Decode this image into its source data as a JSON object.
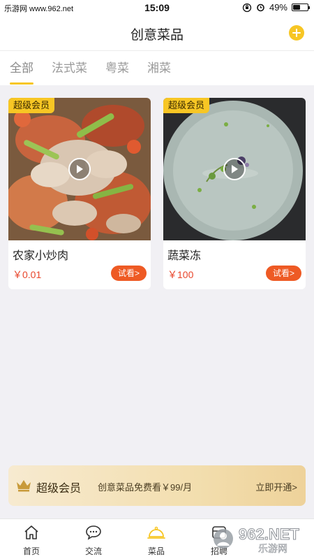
{
  "status": {
    "carrier": "乐游网 www.962.net",
    "time": "15:09",
    "battery_pct_text": "49%",
    "battery_level": 0.49
  },
  "header": {
    "title": "创意菜品"
  },
  "tabs": [
    {
      "label": "全部",
      "active": true
    },
    {
      "label": "法式菜"
    },
    {
      "label": "粤菜"
    },
    {
      "label": "湘菜"
    }
  ],
  "dishes": [
    {
      "badge": "超级会员",
      "name": "农家小炒肉",
      "price": "￥0.01",
      "try_label": "试看>"
    },
    {
      "badge": "超级会员",
      "name": "蔬菜冻",
      "price": "￥100",
      "try_label": "试看>"
    }
  ],
  "member_banner": {
    "title": "超级会员",
    "desc": "创意菜品免费看￥99/月",
    "action": "立即开通>"
  },
  "bottom_nav": [
    {
      "label": "首页",
      "icon": "home-icon"
    },
    {
      "label": "交流",
      "icon": "chat-icon"
    },
    {
      "label": "菜品",
      "icon": "dish-cover-icon",
      "active": true
    },
    {
      "label": "招聘",
      "icon": "recruit-icon"
    }
  ],
  "watermark": {
    "text": "962.NET",
    "subtext": "乐游网"
  },
  "colors": {
    "accent": "#f7c624",
    "try_button": "#ee5a24",
    "price": "#e8462c"
  }
}
